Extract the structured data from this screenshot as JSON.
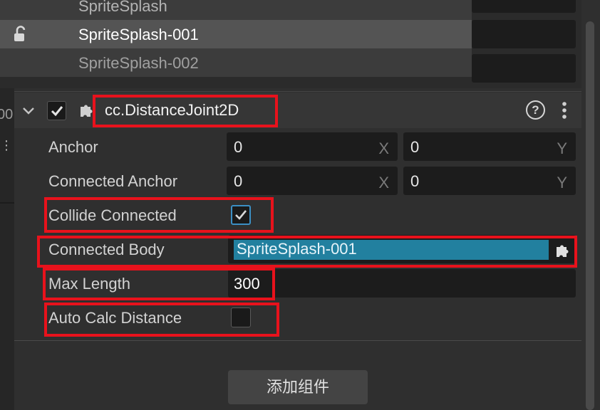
{
  "dropdown": {
    "items": [
      {
        "label": "SpriteSplash"
      },
      {
        "label": "SpriteSplash-001"
      },
      {
        "label": "SpriteSplash-002"
      }
    ]
  },
  "left_strip": {
    "text": "00"
  },
  "component": {
    "title": "cc.DistanceJoint2D",
    "help_label": "?",
    "enabled": true
  },
  "properties": {
    "anchor": {
      "label": "Anchor",
      "x": "0",
      "y": "0",
      "x_axis": "X",
      "y_axis": "Y"
    },
    "connected_anchor": {
      "label": "Connected Anchor",
      "x": "0",
      "y": "0",
      "x_axis": "X",
      "y_axis": "Y"
    },
    "collide_connected": {
      "label": "Collide Connected",
      "checked": true
    },
    "connected_body": {
      "label": "Connected Body",
      "value": "SpriteSplash-001"
    },
    "max_length": {
      "label": "Max Length",
      "value": "300"
    },
    "auto_calc_distance": {
      "label": "Auto Calc Distance",
      "checked": false
    }
  },
  "add_component_button": "添加组件",
  "colors": {
    "highlight": "#e8121c",
    "selection": "#22809f",
    "checkbox_accent": "#3b8fc4",
    "panel_bg": "#2f2f2f"
  },
  "icons": [
    "lock-open-icon",
    "chevron-down-icon",
    "checkmark-icon",
    "puzzle-piece-icon",
    "help-icon",
    "more-vertical-icon"
  ]
}
